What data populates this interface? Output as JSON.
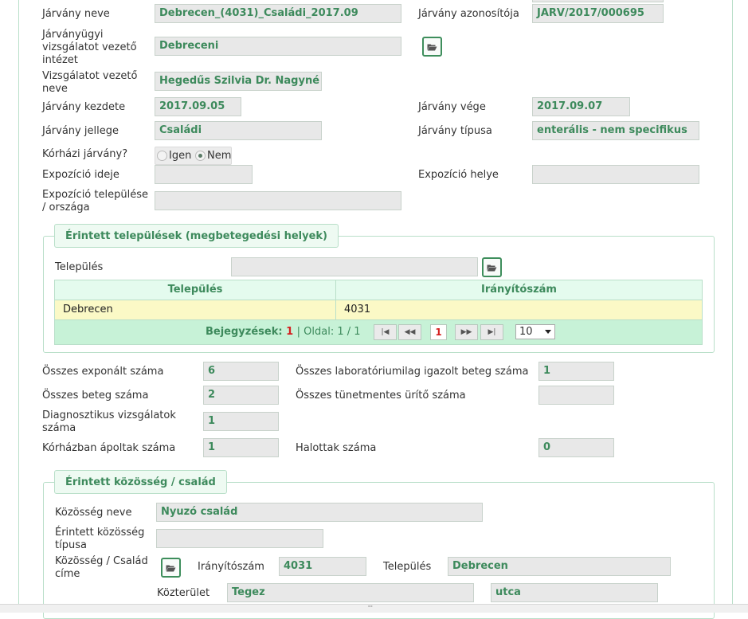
{
  "colors": {
    "accent": "#3d8a5c",
    "border": "#b9dfc9",
    "row_selected": "#fbf9c6",
    "pager_bg": "#c7f2d7",
    "red": "#d41f1f"
  },
  "icons": {
    "folder": "folder-open-icon",
    "first": "first-page-icon",
    "prev": "prev-page-icon",
    "next": "next-page-icon",
    "last": "last-page-icon"
  },
  "form": {
    "jarvany_neve": {
      "label": "Járvány neve",
      "value": "Debrecen_(4031)_Családi_2017.09"
    },
    "jarvany_azonosito": {
      "label": "Járvány azonosítója",
      "value": "JARV/2017/000695"
    },
    "intezet": {
      "label_lines": [
        "Járványügyi",
        "vizsgálatot vezető",
        "intézet"
      ],
      "value": "Debreceni"
    },
    "vezeto": {
      "label_lines": [
        "Vizsgálatot vezető",
        "neve"
      ],
      "value": "Hegedűs Szilvia Dr. Nagyné"
    },
    "kezdete": {
      "label": "Járvány kezdete",
      "value": "2017.09.05"
    },
    "vege": {
      "label": "Járvány vége",
      "value": "2017.09.07"
    },
    "jellege": {
      "label": "Járvány jellege",
      "value": "Családi"
    },
    "tipusa": {
      "label": "Járvány típusa",
      "value": "enterális - nem specifikus"
    },
    "korhazi": {
      "label": "Kórházi járvány?",
      "option_yes": "Igen",
      "option_no": "Nem",
      "selected": "Nem"
    },
    "expo_ideje": {
      "label": "Expozíció ideje",
      "value": ""
    },
    "expo_helye": {
      "label": "Expozíció helye",
      "value": ""
    },
    "expo_telepules": {
      "label_lines": [
        "Expozíció települése",
        "/ országa"
      ],
      "value": ""
    }
  },
  "telepulesek": {
    "legend": "Érintett települések (megbetegedési helyek)",
    "field_label": "Település",
    "field_value": "",
    "columns": [
      "Település",
      "Irányítószám"
    ],
    "rows": [
      [
        "Debrecen",
        "4031"
      ]
    ],
    "pager": {
      "entries_label": "Bejegyzések:",
      "entries_count": "1",
      "page_label": "| Oldal: 1 / 1",
      "current_page": "1",
      "page_size": "10"
    }
  },
  "stats": {
    "exponalt": {
      "label": "Összes exponált száma",
      "value": "6"
    },
    "lab_igazolt": {
      "label": "Összes laboratóriumilag igazolt beteg száma",
      "value": "1"
    },
    "beteg": {
      "label": "Összes beteg száma",
      "value": "2"
    },
    "tunetmentes": {
      "label": "Összes tünetmentes ürítő száma",
      "value": ""
    },
    "diagnosztikus": {
      "label_lines": [
        "Diagnosztikus vizsgálatok",
        "száma"
      ],
      "value": "1"
    },
    "korhaz_apolt": {
      "label": "Kórházban ápoltak száma",
      "value": "1"
    },
    "halottak": {
      "label": "Halottak száma",
      "value": "0"
    }
  },
  "kozosseg": {
    "legend": "Érintett közösség / család",
    "neve": {
      "label": "Közösség neve",
      "value": "Nyuzó család"
    },
    "tipusa": {
      "label_lines": [
        "Érintett közösség",
        "típusa"
      ],
      "value": ""
    },
    "cim": {
      "label_lines": [
        "Közösség / Család",
        "címe"
      ]
    },
    "iranyitoszam": {
      "label": "Irányítószám",
      "value": "4031"
    },
    "telepules": {
      "label": "Település",
      "value": "Debrecen"
    },
    "kozterulet": {
      "label": "Közterület",
      "value": "Tegez",
      "type_value": "utca"
    }
  },
  "scrollbar_grip": "'''"
}
